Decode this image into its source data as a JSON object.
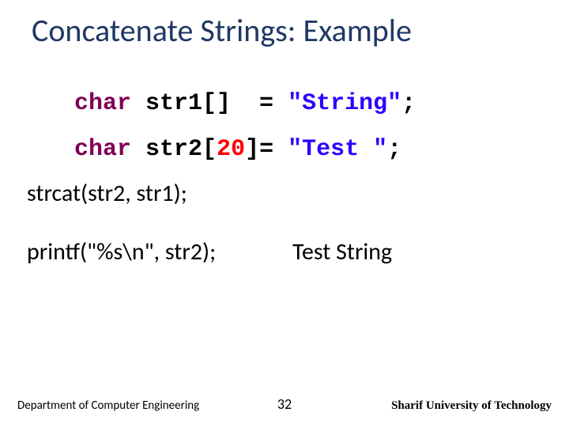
{
  "title": "Concatenate Strings: Example",
  "code": {
    "kw": "char",
    "decl1_mid": " str1[]  = ",
    "decl1_str": "\"String\"",
    "semicolon": ";",
    "decl2_mid1": " str2[",
    "decl2_num": "20",
    "decl2_mid2": "]= ",
    "decl2_str": "\"Test \""
  },
  "body": {
    "line3": "strcat(str2, str1);",
    "line4": "printf(\"%s\\n\", str2);",
    "output": "Test String"
  },
  "footer": {
    "dept": "Department of Computer Engineering",
    "page": "32",
    "uni": "Sharif University of Technology"
  }
}
